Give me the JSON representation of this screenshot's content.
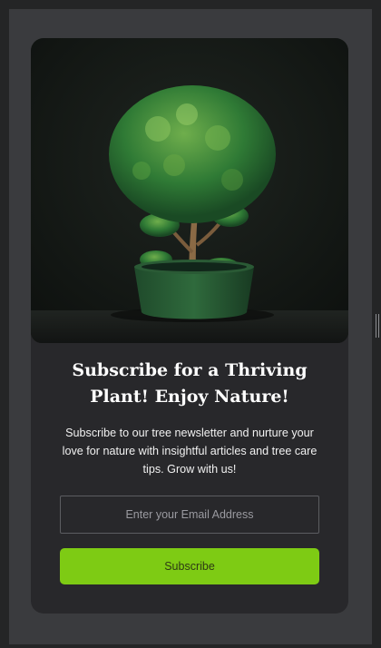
{
  "newsletter": {
    "headline": "Subscribe for a Thriving Plant! Enjoy Nature!",
    "description": "Subscribe to our tree newsletter and nurture your love for nature with insightful articles and tree care tips. Grow with us!",
    "email_placeholder": "Enter your Email Address",
    "subscribe_label": "Subscribe",
    "hero_image": "bonsai-tree-in-green-pot"
  },
  "colors": {
    "page_background": "#242526",
    "frame_background": "#3a3b3e",
    "card_background": "#28282b",
    "accent": "#7ecb14"
  }
}
